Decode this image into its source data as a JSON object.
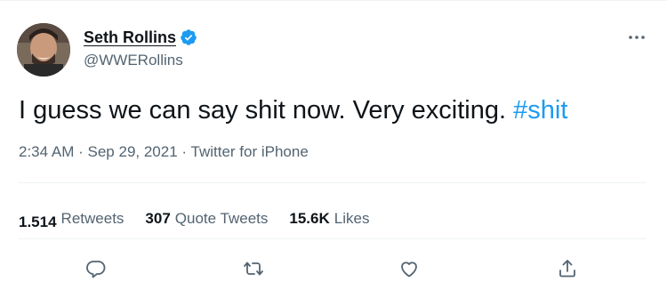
{
  "author": {
    "display_name": "Seth Rollins",
    "handle": "@WWERollins",
    "verified": true
  },
  "tweet": {
    "text": "I guess we can say shit now. Very exciting.",
    "hashtag": "#shit"
  },
  "meta": {
    "time": "2:34 AM",
    "date": "Sep 29, 2021",
    "source": "Twitter for iPhone",
    "separator": "·"
  },
  "stats": {
    "retweets_count": "1.514",
    "retweets_label": "Retweets",
    "quotes_count": "307",
    "quotes_label": "Quote Tweets",
    "likes_count": "15.6K",
    "likes_label": "Likes"
  },
  "icons": {
    "more": "more-horizontal-icon",
    "verified": "verified-badge-icon",
    "reply": "reply-icon",
    "retweet": "retweet-icon",
    "like": "heart-icon",
    "share": "share-icon"
  },
  "colors": {
    "link_blue": "#1d9bf0",
    "text_primary": "#0f1419",
    "text_secondary": "#536471",
    "divider": "#eff3f4"
  }
}
